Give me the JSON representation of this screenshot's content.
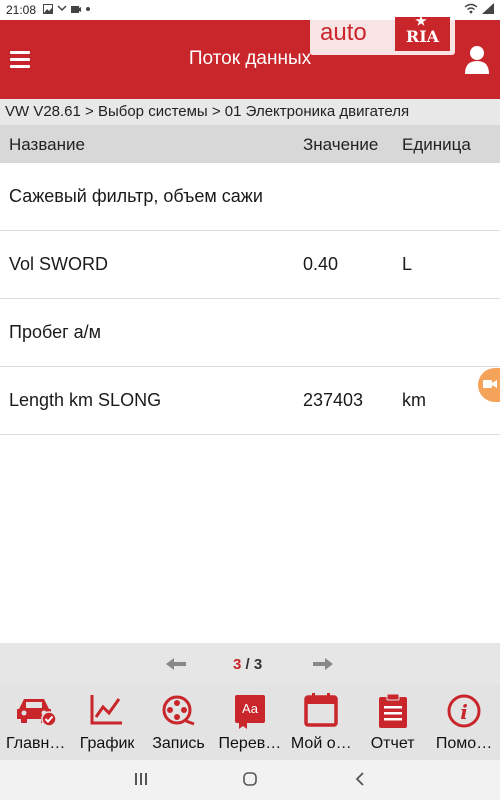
{
  "status_bar": {
    "time": "21:08"
  },
  "app_bar": {
    "title": "Поток данных"
  },
  "watermark": {
    "auto": "auto",
    "ria": "RIA"
  },
  "breadcrumb": "VW V28.61 > Выбор системы > 01 Электроника двигателя",
  "table": {
    "headers": {
      "name": "Название",
      "value": "Значение",
      "unit": "Единица"
    },
    "rows": [
      {
        "name": "Сажевый фильтр, объем сажи",
        "value": "",
        "unit": ""
      },
      {
        "name": "Vol SWORD",
        "value": "0.40",
        "unit": "L"
      },
      {
        "name": "Пробег а/м",
        "value": "",
        "unit": ""
      },
      {
        "name": "Length km SLONG",
        "value": "237403",
        "unit": "km"
      }
    ]
  },
  "pagination": {
    "current": "3",
    "separator": " / ",
    "total": "3"
  },
  "toolbar": [
    {
      "label": "Главн…",
      "icon": "car-check-icon"
    },
    {
      "label": "График",
      "icon": "graph-icon"
    },
    {
      "label": "Запись",
      "icon": "record-film-icon"
    },
    {
      "label": "Перев…",
      "icon": "translate-icon"
    },
    {
      "label": "Мой о…",
      "icon": "calendar-icon"
    },
    {
      "label": "Отчет",
      "icon": "report-icon"
    },
    {
      "label": "Помо…",
      "icon": "info-icon"
    }
  ],
  "colors": {
    "accent": "#c9262b",
    "toolbar_bg": "#e3e3e3",
    "header_bg": "#d8d8d8"
  }
}
